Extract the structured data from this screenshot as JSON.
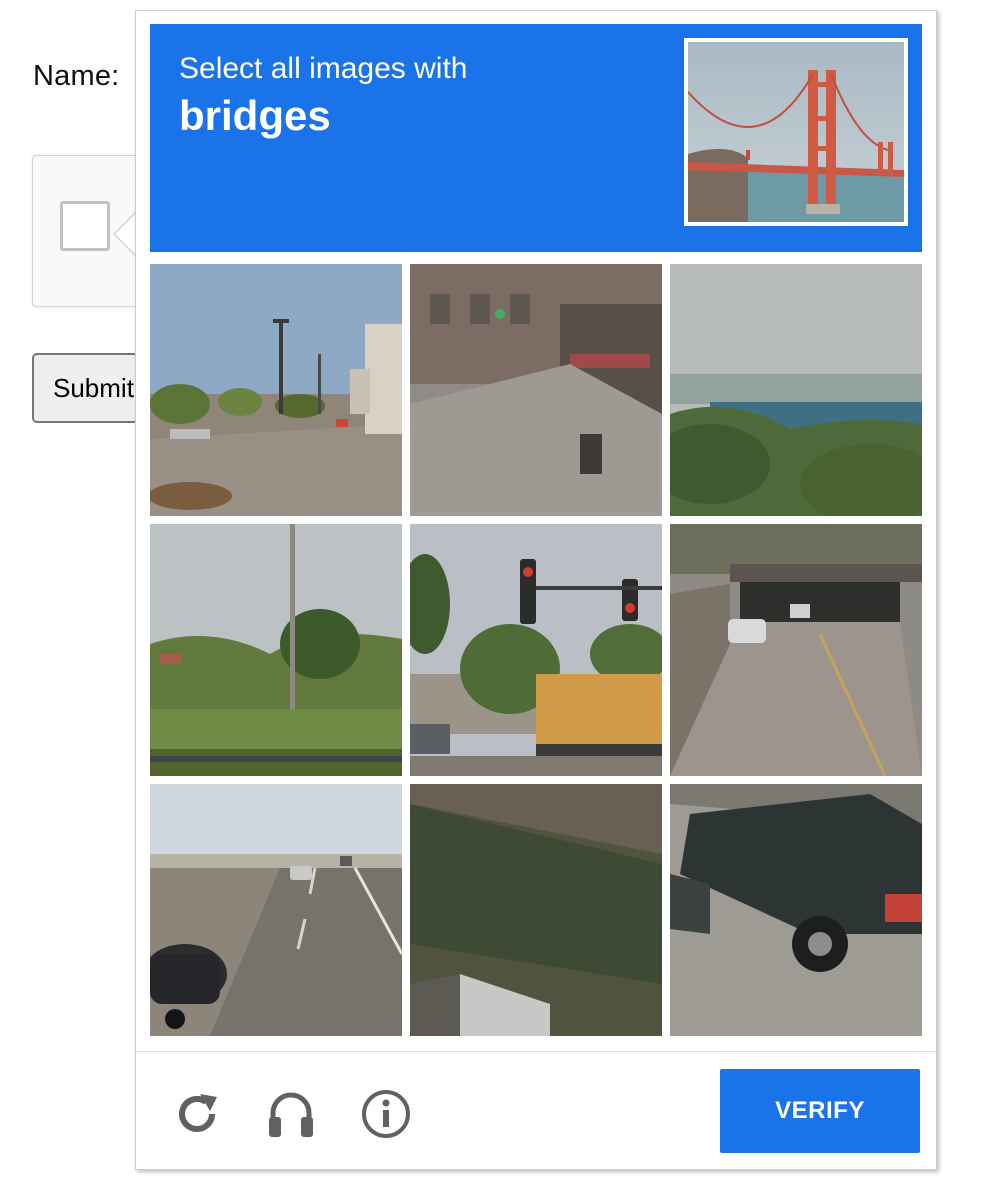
{
  "page": {
    "name_label": "Name:",
    "submit_label": "Submit"
  },
  "challenge": {
    "instruction": "Select all images with",
    "keyword": "bridges",
    "sample_image": "golden-gate-bridge",
    "tiles": [
      {
        "label": "parking-lot-street"
      },
      {
        "label": "noisy-building-facade"
      },
      {
        "label": "bridge-over-trees"
      },
      {
        "label": "light-pole-and-trees"
      },
      {
        "label": "traffic-lights-and-truck"
      },
      {
        "label": "road-under-overpass"
      },
      {
        "label": "highway-with-cars"
      },
      {
        "label": "noisy-building-angle"
      },
      {
        "label": "noisy-pickup-truck"
      }
    ],
    "footer": {
      "reload_icon": "reload-icon",
      "audio_icon": "headphones-icon",
      "info_icon": "info-icon",
      "verify_label": "VERIFY"
    }
  },
  "colors": {
    "accent": "#1a73e8",
    "footer_icon": "#616161"
  }
}
